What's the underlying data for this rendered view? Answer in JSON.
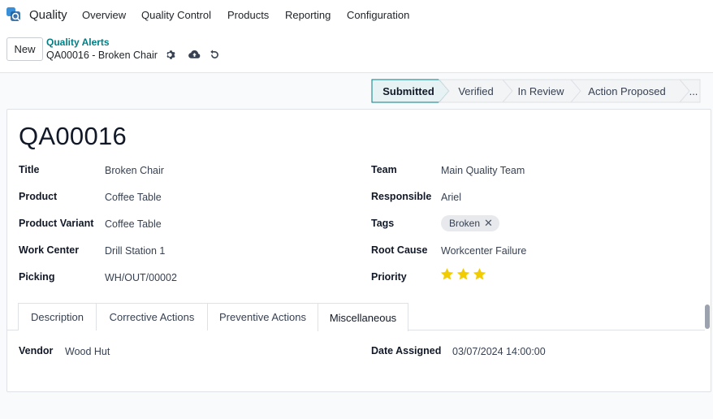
{
  "navbar": {
    "app_name": "Quality",
    "menus": [
      "Overview",
      "Quality Control",
      "Products",
      "Reporting",
      "Configuration"
    ]
  },
  "control_panel": {
    "new_label": "New",
    "breadcrumb_parent": "Quality Alerts",
    "breadcrumb_current": "QA00016 - Broken Chair"
  },
  "statusbar": {
    "stages": [
      "Submitted",
      "Verified",
      "In Review",
      "Action Proposed",
      "..."
    ],
    "active_stage": "Submitted"
  },
  "record": {
    "name": "QA00016",
    "left_fields": [
      {
        "label": "Title",
        "value": "Broken Chair"
      },
      {
        "label": "Product",
        "value": "Coffee Table"
      },
      {
        "label": "Product Variant",
        "value": "Coffee Table"
      },
      {
        "label": "Work Center",
        "value": "Drill Station 1"
      },
      {
        "label": "Picking",
        "value": "WH/OUT/00002"
      }
    ],
    "right_fields": [
      {
        "label": "Team",
        "value": "Main Quality Team"
      },
      {
        "label": "Responsible",
        "value": "Ariel"
      },
      {
        "label": "Tags",
        "value": ""
      },
      {
        "label": "Root Cause",
        "value": "Workcenter Failure"
      },
      {
        "label": "Priority",
        "value": ""
      }
    ],
    "tag": "Broken",
    "priority_stars": 3,
    "star_color": "#f3cc00"
  },
  "tabs": {
    "items": [
      "Description",
      "Corrective Actions",
      "Preventive Actions",
      "Miscellaneous"
    ],
    "active": "Miscellaneous"
  },
  "misc": {
    "vendor_label": "Vendor",
    "vendor_value": "Wood Hut",
    "date_label": "Date Assigned",
    "date_value": "03/07/2024 14:00:00"
  },
  "colors": {
    "accent": "#017e84",
    "active_stage_bg": "#e6f2f3",
    "active_stage_border": "#017e84"
  }
}
